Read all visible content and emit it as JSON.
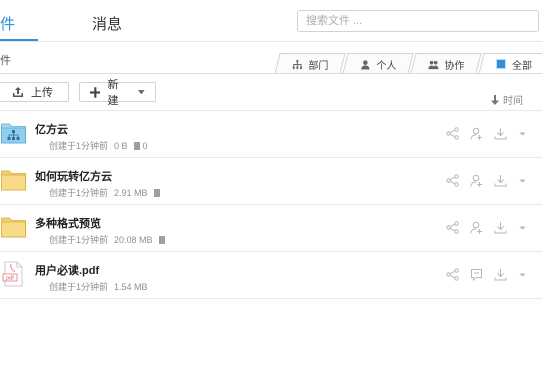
{
  "header": {
    "tabs": [
      {
        "label": "件",
        "active": true
      },
      {
        "label": "消息",
        "active": false
      }
    ],
    "search_placeholder": "搜索文件 ..."
  },
  "breadcrumb": "件",
  "filter_tabs": [
    {
      "label": "部门",
      "icon": "org-chart-icon"
    },
    {
      "label": "个人",
      "icon": "person-icon"
    },
    {
      "label": "协作",
      "icon": "people-icon"
    },
    {
      "label": "全部",
      "icon": "all-square-icon",
      "active": true
    }
  ],
  "toolbar": {
    "upload_label": "上传",
    "new_label": "新建",
    "sort_label": "时间"
  },
  "files": [
    {
      "name": "亿方云",
      "type": "org-folder",
      "created": "创建于1分钟前",
      "size": "0 B",
      "count": "0"
    },
    {
      "name": "如何玩转亿方云",
      "type": "folder",
      "created": "创建于1分钟前",
      "size": "2.91 MB",
      "count": ""
    },
    {
      "name": "多种格式预览",
      "type": "folder",
      "created": "创建于1分钟前",
      "size": "20.08 MB",
      "count": ""
    },
    {
      "name": "用户必读.pdf",
      "type": "pdf",
      "created": "创建于1分钟前",
      "size": "1.54 MB",
      "count": ""
    }
  ],
  "pdf_badge": "pdf",
  "colors": {
    "accent": "#2f8fd8",
    "folder": "#f6d47a",
    "folder_shared": "#7fc6ea",
    "icon_gray": "#b3b8be"
  }
}
